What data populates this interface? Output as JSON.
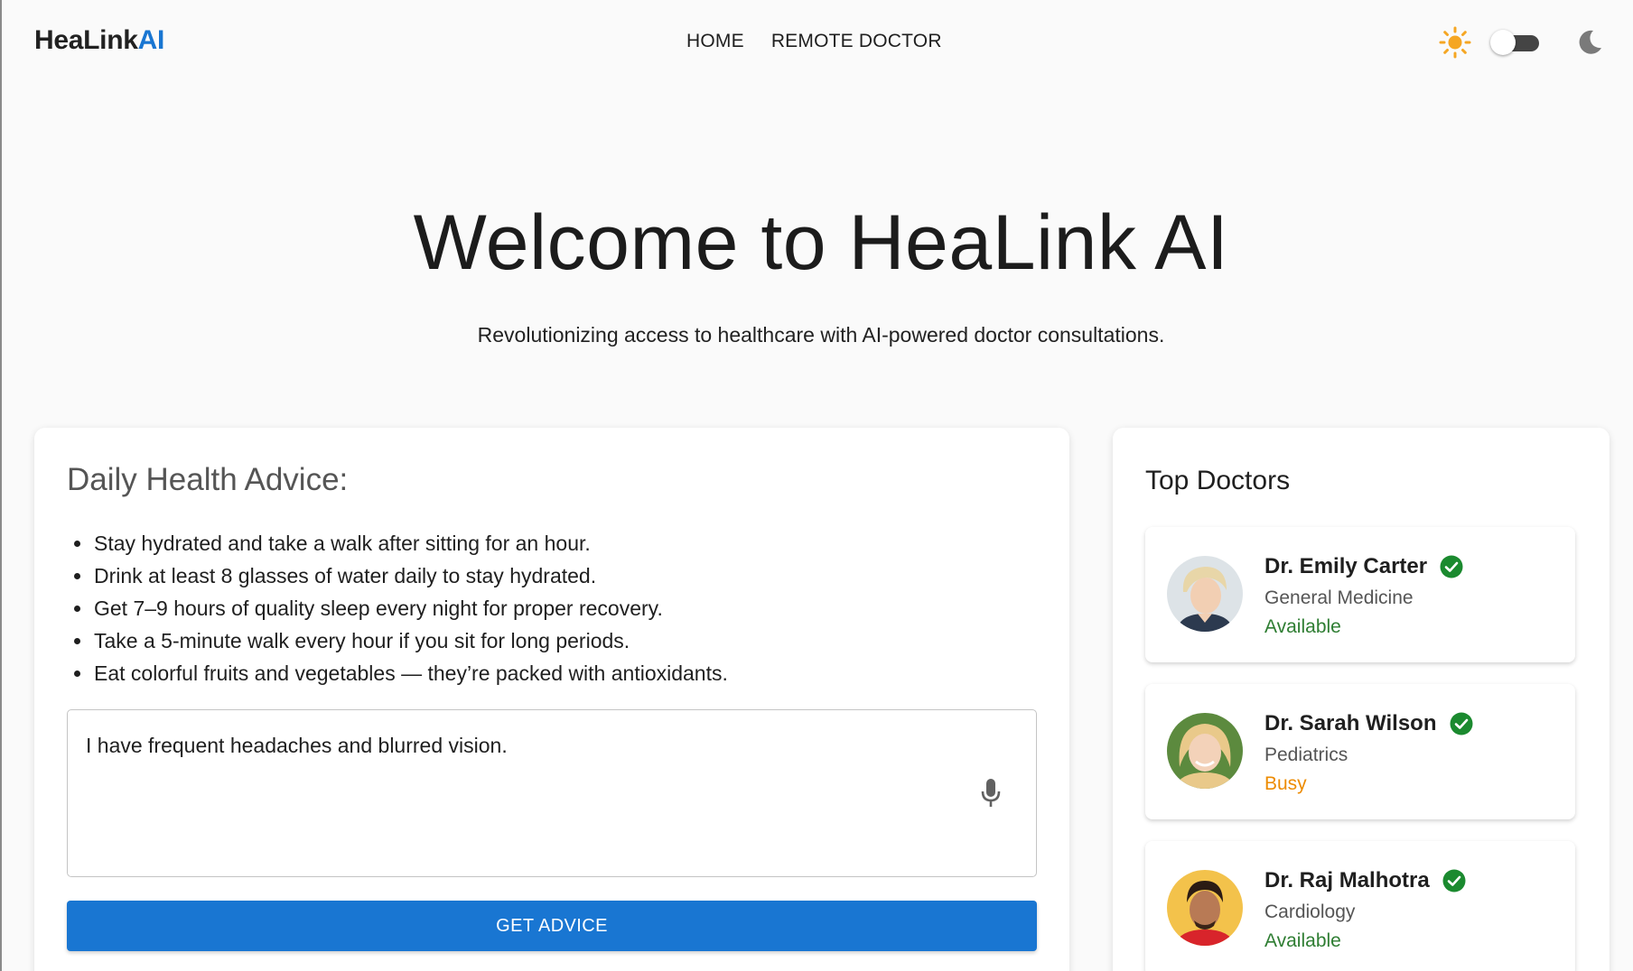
{
  "header": {
    "logo_main": "HeaLink",
    "logo_accent": "AI",
    "nav": [
      {
        "label": "HOME"
      },
      {
        "label": "REMOTE DOCTOR"
      }
    ],
    "theme": {
      "light_icon": "sun-icon",
      "dark_icon": "moon-icon",
      "toggle_state": "light"
    }
  },
  "hero": {
    "title": "Welcome to HeaLink AI",
    "subtitle": "Revolutionizing access to healthcare with AI-powered doctor consultations."
  },
  "advice": {
    "title": "Daily Health Advice:",
    "tips": [
      "Stay hydrated and take a walk after sitting for an hour.",
      "Drink at least 8 glasses of water daily to stay hydrated.",
      "Get 7–9 hours of quality sleep every night for proper recovery.",
      "Take a 5-minute walk every hour if you sit for long periods.",
      "Eat colorful fruits and vegetables — they’re packed with antioxidants."
    ],
    "symptom_input_value": "I have frequent headaches and blurred vision.",
    "mic_icon": "microphone-icon",
    "button_label": "GET ADVICE"
  },
  "doctors": {
    "title": "Top Doctors",
    "items": [
      {
        "name": "Dr. Emily Carter",
        "specialty": "General Medicine",
        "status": "Available",
        "verified": true
      },
      {
        "name": "Dr. Sarah Wilson",
        "specialty": "Pediatrics",
        "status": "Busy",
        "verified": true
      },
      {
        "name": "Dr. Raj Malhotra",
        "specialty": "Cardiology",
        "status": "Available",
        "verified": true
      }
    ]
  },
  "colors": {
    "accent": "#1976d2",
    "available": "#2e7d32",
    "busy": "#ed8b00",
    "verified": "#1b8a2f",
    "sun": "#f5a623"
  }
}
